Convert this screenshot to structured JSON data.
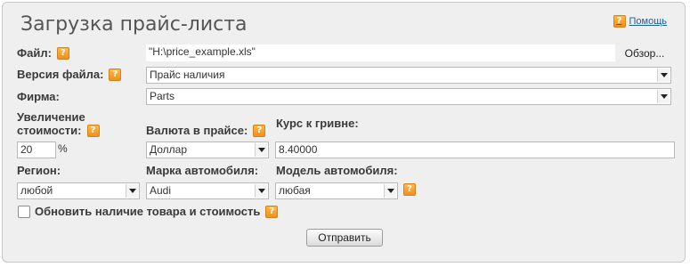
{
  "title": "Загрузка прайс-листа",
  "help_label": "Помощь",
  "file": {
    "label": "Файл:",
    "value": "\"H:\\price_example.xls\"",
    "browse_label": "Обзор..."
  },
  "version": {
    "label": "Версия файла:",
    "value": "Прайс наличия"
  },
  "firm": {
    "label": "Фирма:",
    "value": "Parts"
  },
  "increase": {
    "label_line1": "Увеличение",
    "label_line2": "стоимости:",
    "value": "20",
    "unit": "%"
  },
  "currency": {
    "label": "Валюта в прайсе:",
    "value": "Доллар"
  },
  "rate": {
    "label": "Курс к гривне:",
    "value": "8.40000"
  },
  "region": {
    "label": "Регион:",
    "value": "любой"
  },
  "car_brand": {
    "label": "Марка автомобиля:",
    "value": "Audi"
  },
  "car_model": {
    "label": "Модель автомобиля:",
    "value": "любая"
  },
  "update_checkbox": {
    "label": "Обновить наличие товара и стоимость",
    "checked": false
  },
  "submit_label": "Отправить",
  "colors": {
    "panel_bg": "#efefef",
    "link": "#1a5ea8",
    "help_icon": "#f0901a"
  }
}
